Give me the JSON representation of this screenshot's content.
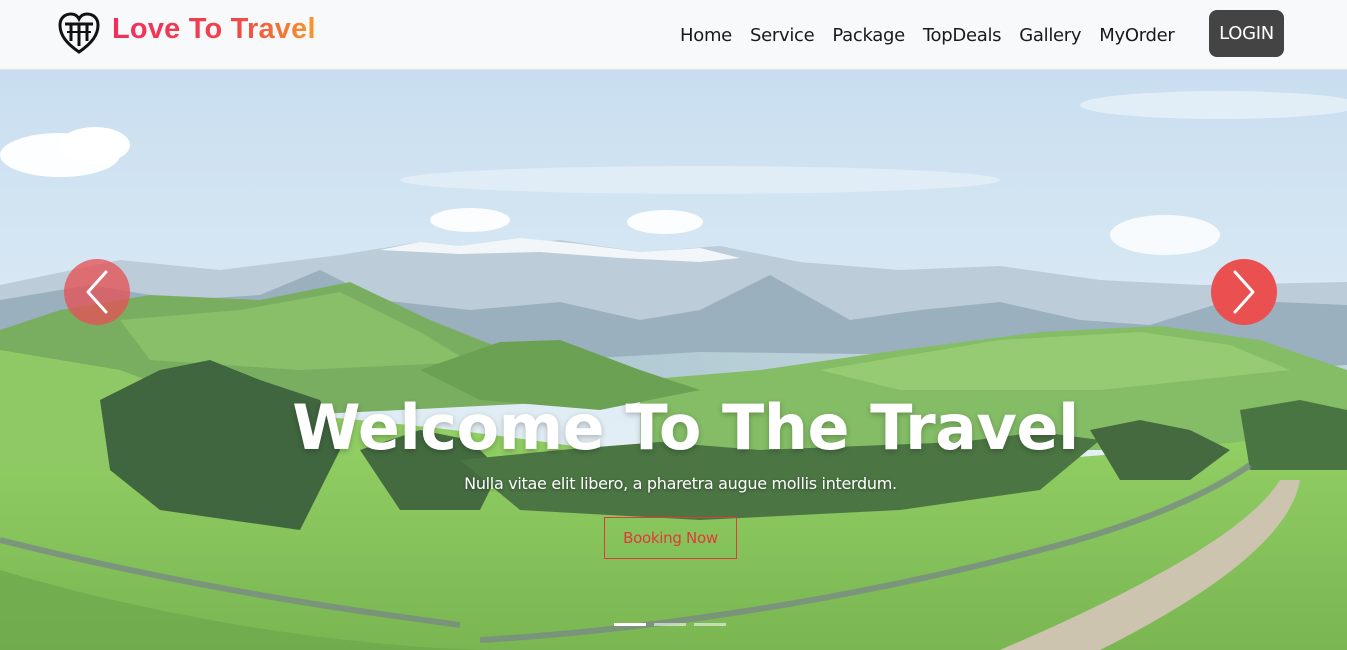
{
  "brand": {
    "name": "Love To Travel",
    "logo_icon": "heart-shield-logo"
  },
  "nav": {
    "items": [
      {
        "label": "Home"
      },
      {
        "label": "Service"
      },
      {
        "label": "Package"
      },
      {
        "label": "TopDeals"
      },
      {
        "label": "Gallery"
      },
      {
        "label": "MyOrder"
      }
    ],
    "login_label": "LOGIN"
  },
  "hero": {
    "title": "Welcome To The Travel",
    "subtitle": "Nulla vitae elit libero, a pharetra augue mollis interdum.",
    "cta_label": "Booking Now",
    "prev_icon": "chevron-left-icon",
    "next_icon": "chevron-right-icon",
    "slides_total": 3,
    "active_slide": 1
  },
  "colors": {
    "accent": "#e9504f",
    "nav_bg": "#f8f9fa",
    "login_bg": "#444444",
    "brand_gradient_start": "#ef2f5d",
    "brand_gradient_end": "#f59a2b"
  }
}
